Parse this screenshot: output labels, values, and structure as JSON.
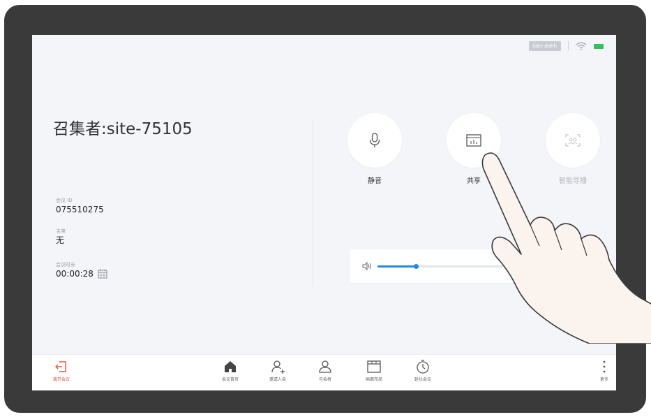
{
  "status": {
    "label": "labz dahh",
    "wifi_icon": "wifi-icon",
    "battery_icon": "battery-icon",
    "battery_color": "#35c05a"
  },
  "meeting": {
    "host_title": "召集者:site-75105",
    "id_label": "会议 ID",
    "id_value": "075510275",
    "chair_label": "主席",
    "chair_value": "无",
    "duration_label": "会议时长",
    "duration_value": "00:00:28"
  },
  "actions": [
    {
      "label": "静音",
      "icon": "microphone-icon"
    },
    {
      "label": "共享",
      "icon": "share-screen-icon"
    },
    {
      "label": "智能导播",
      "icon": "smart-director-icon",
      "disabled": true
    }
  ],
  "volume": {
    "level": 0.28,
    "icon": "speaker-icon",
    "accent": "#1e88e5"
  },
  "toolbar": {
    "leave": "离开会议",
    "home": "会议首页",
    "invite": "邀请入会",
    "participants": "与会者",
    "layout": "画面布局",
    "extend": "延长会议",
    "more": "更多",
    "leave_color": "#e0533e"
  }
}
